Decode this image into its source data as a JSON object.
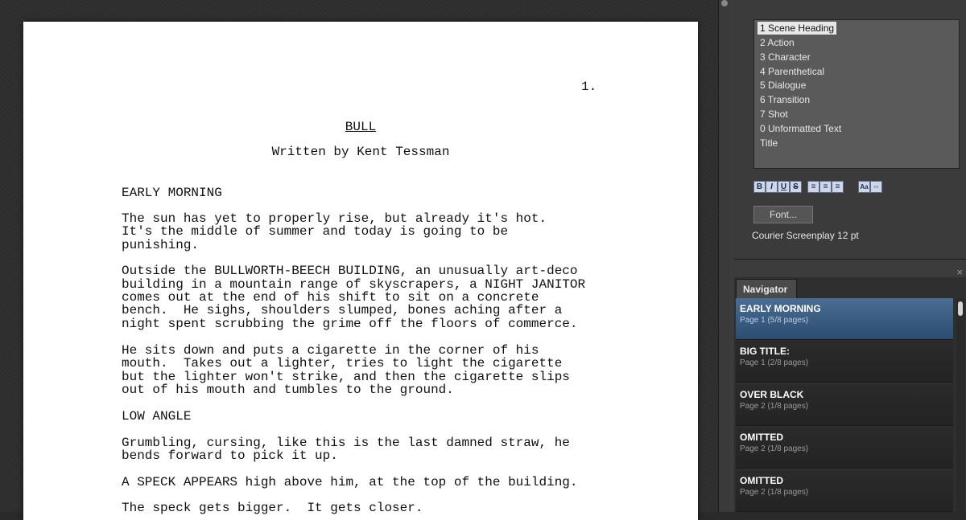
{
  "document": {
    "page_number": "1.",
    "title": "BULL",
    "byline": "Written by Kent Tessman",
    "lines": [
      "EARLY MORNING",
      "The sun has yet to properly rise, but already it's hot.",
      "It's the middle of summer and today is going to be",
      "punishing.",
      "Outside the BULLWORTH-BEECH BUILDING, an unusually art-deco",
      "building in a mountain range of skyscrapers, a NIGHT JANITOR",
      "comes out at the end of his shift to sit on a concrete",
      "bench.  He sighs, shoulders slumped, bones aching after a",
      "night spent scrubbing the grime off the floors of commerce.",
      "He sits down and puts a cigarette in the corner of his",
      "mouth.  Takes out a lighter, tries to light the cigarette",
      "but the lighter won't strike, and then the cigarette slips",
      "out of his mouth and tumbles to the ground.",
      "LOW ANGLE",
      "Grumbling, cursing, like this is the last damned straw, he",
      "bends forward to pick it up.",
      "A SPECK APPEARS high above him, at the top of the building.",
      "The speck gets bigger.  It gets closer."
    ]
  },
  "elements": {
    "items": [
      "1 Scene Heading",
      "2 Action",
      "3 Character",
      "4 Parenthetical",
      "5 Dialogue",
      "6 Transition",
      "7 Shot",
      "0 Unformatted Text",
      "Title"
    ],
    "selected_index": 0,
    "format_buttons": [
      "B",
      "I",
      "U",
      "S",
      "≡",
      "≡",
      "≡",
      "Aa",
      "⇔"
    ],
    "font_button": "Font...",
    "font_label": "Courier Screenplay 12 pt"
  },
  "navigator": {
    "tab_label": "Navigator",
    "close_glyph": "×",
    "items": [
      {
        "title": "EARLY MORNING",
        "sub": "Page 1 (5/8 pages)"
      },
      {
        "title": "BIG TITLE:",
        "sub": "Page 1 (2/8 pages)"
      },
      {
        "title": "OVER BLACK",
        "sub": "Page 2 (1/8 pages)"
      },
      {
        "title": "OMITTED",
        "sub": "Page 2 (1/8 pages)"
      },
      {
        "title": "OMITTED",
        "sub": "Page 2 (1/8 pages)"
      }
    ]
  },
  "colors": {
    "navigator_selected": "#3e6088",
    "page_background": "#ffffff",
    "workspace_background": "#2d2d2d"
  },
  "icons": [
    "close-icon",
    "bold-icon",
    "italic-icon",
    "underline-icon",
    "strikethrough-icon",
    "align-left-icon",
    "align-center-icon",
    "align-right-icon",
    "font-size-icon",
    "swap-icon"
  ]
}
